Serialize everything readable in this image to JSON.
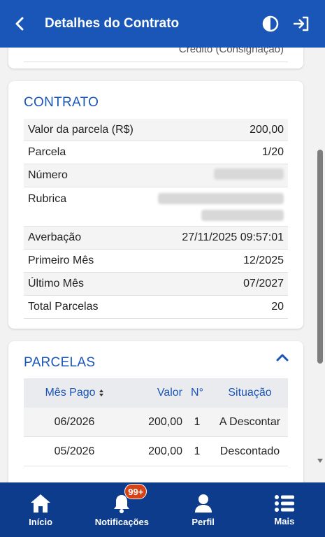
{
  "header": {
    "title": "Detalhes do Contrato"
  },
  "prev_card": {
    "tail_text": "Crédito (Consignação)"
  },
  "contrato": {
    "title": "CONTRATO",
    "rows": [
      {
        "label": "Valor da parcela (R$)",
        "value": "200,00"
      },
      {
        "label": "Parcela",
        "value": "1/20"
      },
      {
        "label": "Número",
        "value": ""
      },
      {
        "label": "Rubrica",
        "value": ""
      },
      {
        "label": "Averbação",
        "value": "27/11/2025 09:57:01"
      },
      {
        "label": "Primeiro Mês",
        "value": "12/2025"
      },
      {
        "label": "Último Mês",
        "value": "07/2027"
      },
      {
        "label": "Total Parcelas",
        "value": "20"
      }
    ]
  },
  "parcelas": {
    "title": "PARCELAS",
    "columns": [
      "Mês Pago",
      "Valor",
      "N°",
      "Situação"
    ],
    "rows": [
      {
        "mes": "06/2026",
        "valor": "200,00",
        "n": "1",
        "situacao": "A Descontar"
      },
      {
        "mes": "05/2026",
        "valor": "200,00",
        "n": "1",
        "situacao": "Descontado"
      }
    ]
  },
  "bottom_nav": {
    "items": [
      {
        "label": "Início",
        "icon": "home-icon"
      },
      {
        "label": "Notificações",
        "icon": "bell-icon",
        "badge": "99+"
      },
      {
        "label": "Perfil",
        "icon": "user-icon"
      },
      {
        "label": "Mais",
        "icon": "menu-list-icon"
      }
    ]
  },
  "colors": {
    "primary": "#1956b8",
    "nav": "#0d3c8c",
    "badge": "#d84315"
  }
}
